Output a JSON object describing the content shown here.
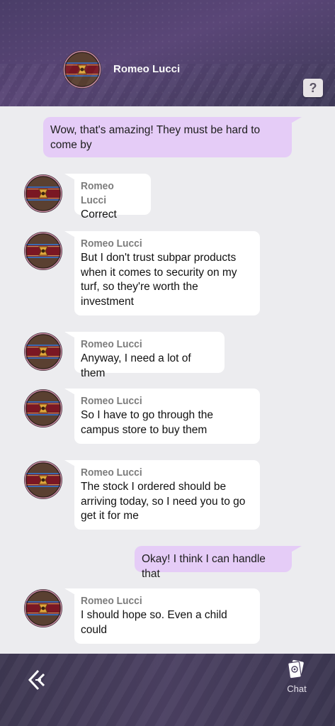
{
  "header": {
    "contact_name": "Romeo Lucci",
    "help_label": "?"
  },
  "messages": [
    {
      "kind": "out",
      "text": "Wow, that's amazing! They must be hard to come by"
    },
    {
      "kind": "in",
      "sender": "Romeo Lucci",
      "text": "Correct"
    },
    {
      "kind": "in",
      "sender": "Romeo Lucci",
      "text": "But I don't trust subpar products when it comes to security on my turf, so they're worth the investment"
    },
    {
      "kind": "in",
      "sender": "Romeo Lucci",
      "text": "Anyway, I need a lot of them"
    },
    {
      "kind": "in",
      "sender": "Romeo Lucci",
      "text": "So I have to go through the campus store to buy them"
    },
    {
      "kind": "in",
      "sender": "Romeo Lucci",
      "text": "The stock I ordered should be arriving today, so I need you to go get it for me"
    },
    {
      "kind": "out",
      "text": "Okay! I think I can handle that"
    },
    {
      "kind": "in",
      "sender": "Romeo Lucci",
      "text": "I should hope so. Even a child could"
    }
  ],
  "footer": {
    "chat_tab_label": "Chat",
    "back_icon": "back-chevron-icon",
    "chat_icon": "card-chat-icon"
  },
  "colors": {
    "header_bg": "#4a3d68",
    "incoming_bubble": "#ffffff",
    "outgoing_bubble": "#e5ccf7",
    "chat_bg": "#ececef",
    "sender_name": "#7c7c7c"
  }
}
